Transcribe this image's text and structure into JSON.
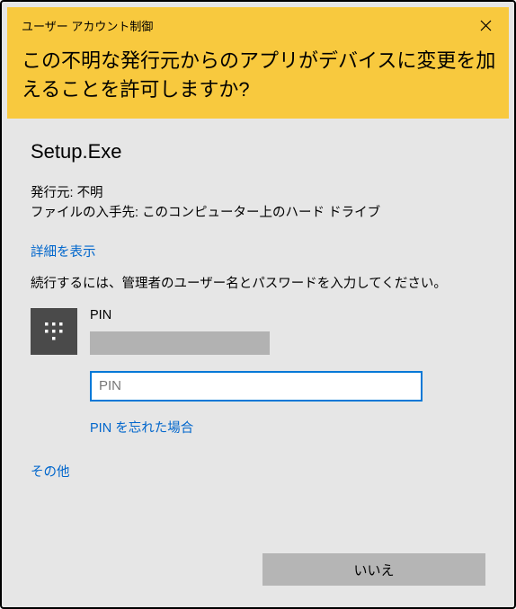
{
  "header": {
    "title": "ユーザー アカウント制御",
    "heading": "この不明な発行元からのアプリがデバイスに変更を加えることを許可しますか?"
  },
  "body": {
    "app_name": "Setup.Exe",
    "publisher_label": "発行元:",
    "publisher_value": "不明",
    "origin_label": "ファイルの入手先:",
    "origin_value": "このコンピューター上のハード ドライブ",
    "show_details": "詳細を表示",
    "instruction": "続行するには、管理者のユーザー名とパスワードを入力してください。",
    "pin_label": "PIN",
    "pin_placeholder": "PIN",
    "forgot_pin": "PIN を忘れた場合",
    "other_options": "その他"
  },
  "footer": {
    "no_label": "いいえ"
  }
}
